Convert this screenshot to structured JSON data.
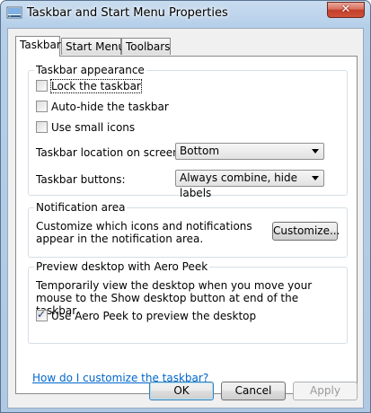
{
  "window": {
    "title": "Taskbar and Start Menu Properties",
    "close_glyph": "✕"
  },
  "tabs": [
    {
      "label": "Taskbar",
      "active": true
    },
    {
      "label": "Start Menu",
      "active": false
    },
    {
      "label": "Toolbars",
      "active": false
    }
  ],
  "appearance": {
    "title": "Taskbar appearance",
    "lock_taskbar": {
      "label": "Lock the taskbar",
      "checked": false
    },
    "auto_hide": {
      "label": "Auto-hide the taskbar",
      "checked": false
    },
    "small_icons": {
      "label": "Use small icons",
      "checked": false
    },
    "location_label": "Taskbar location on screen:",
    "location_value": "Bottom",
    "buttons_label": "Taskbar buttons:",
    "buttons_value": "Always combine, hide labels"
  },
  "notification": {
    "title": "Notification area",
    "description": "Customize which icons and notifications appear in the notification area.",
    "customize_label": "Customize..."
  },
  "aero_peek": {
    "title": "Preview desktop with Aero Peek",
    "description": "Temporarily view the desktop when you move your mouse to the Show desktop button at end of the taskbar.",
    "use_aero_peek": {
      "label": "Use Aero Peek to preview the desktop",
      "checked": true
    }
  },
  "help_link": "How do I customize the taskbar?",
  "footer": {
    "ok_label": "OK",
    "cancel_label": "Cancel",
    "apply_label": "Apply"
  },
  "icons": {
    "app": "taskbar-properties-icon",
    "close": "close-icon",
    "check": "checkmark-icon",
    "dropdown": "chevron-down-icon"
  }
}
